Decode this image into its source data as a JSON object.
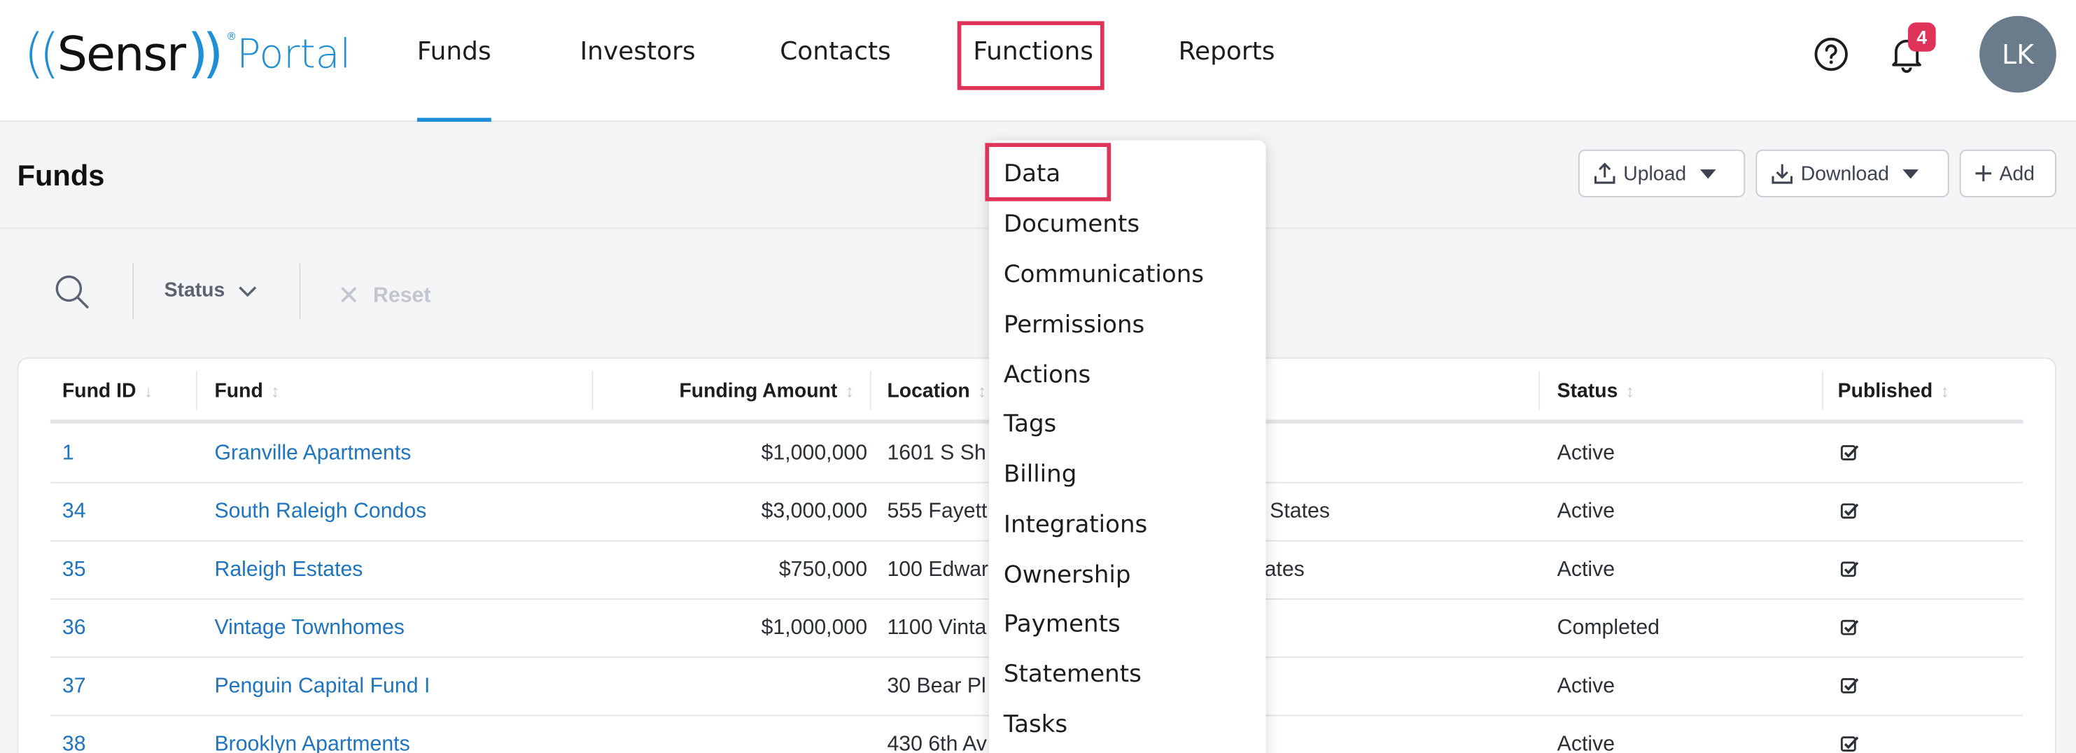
{
  "logo": {
    "left_paren": "((",
    "brand": "Sensr",
    "right_paren": "))",
    "registered": "®",
    "portal": "Portal"
  },
  "nav": {
    "funds": "Funds",
    "investors": "Investors",
    "contacts": "Contacts",
    "functions": "Functions",
    "reports": "Reports"
  },
  "header": {
    "notification_count": "4",
    "avatar_initials": "LK"
  },
  "page": {
    "title": "Funds"
  },
  "actions": {
    "upload": "Upload",
    "download": "Download",
    "add": "Add"
  },
  "filters": {
    "status": "Status",
    "reset": "Reset"
  },
  "table": {
    "columns": {
      "fund_id": "Fund ID",
      "fund": "Fund",
      "funding_amount": "Funding Amount",
      "location": "Location",
      "status": "Status",
      "published": "Published"
    },
    "rows": [
      {
        "id": "1",
        "fund": "Granville Apartments",
        "amount": "$1,000,000",
        "location": "1601 S Sh",
        "location_tail": "",
        "status": "Active",
        "published": true
      },
      {
        "id": "34",
        "fund": "South Raleigh Condos",
        "amount": "$3,000,000",
        "location": "555 Fayett",
        "location_tail": "States",
        "status": "Active",
        "published": true
      },
      {
        "id": "35",
        "fund": "Raleigh Estates",
        "amount": "$750,000",
        "location": "100 Edwar",
        "location_tail": "ates",
        "status": "Active",
        "published": true
      },
      {
        "id": "36",
        "fund": "Vintage Townhomes",
        "amount": "$1,000,000",
        "location": "1100 Vinta",
        "location_tail": "",
        "status": "Completed",
        "published": true
      },
      {
        "id": "37",
        "fund": "Penguin Capital Fund I",
        "amount": "",
        "location": "30 Bear Pl",
        "location_tail": "",
        "status": "Active",
        "published": true
      },
      {
        "id": "38",
        "fund": "Brooklyn Apartments",
        "amount": "",
        "location": "430 6th Av",
        "location_tail": "",
        "status": "Active",
        "published": true
      }
    ]
  },
  "functions_menu": {
    "items": [
      "Data",
      "Documents",
      "Communications",
      "Permissions",
      "Actions",
      "Tags",
      "Billing",
      "Integrations",
      "Ownership",
      "Payments",
      "Statements",
      "Tasks"
    ]
  },
  "colors": {
    "accent": "#1e8fd6",
    "highlight": "#e0335a",
    "link": "#1f74c0",
    "badge": "#e0335a",
    "avatar": "#6a7b8c"
  }
}
